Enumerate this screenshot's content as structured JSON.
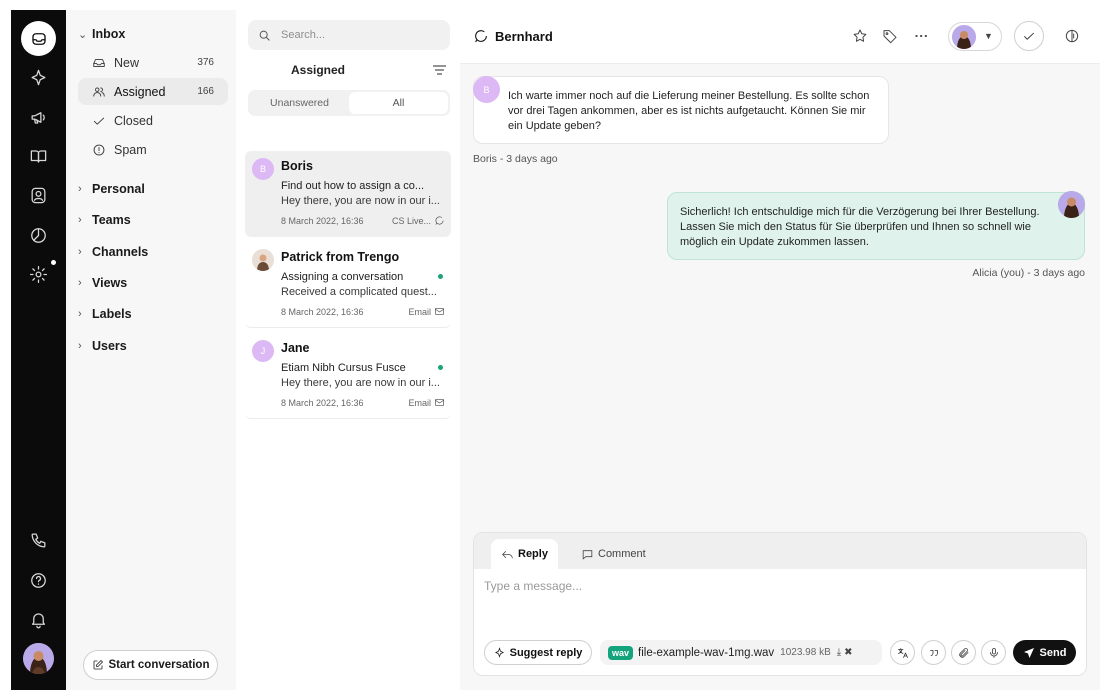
{
  "rail": {
    "icons": [
      "inbox-icon",
      "sparkle-icon",
      "megaphone-icon",
      "book-icon",
      "contacts-icon",
      "reports-icon",
      "settings-icon",
      "phone-icon",
      "help-icon",
      "bell-icon"
    ]
  },
  "nav": {
    "inbox_label": "Inbox",
    "items": [
      {
        "label": "New",
        "count": "376"
      },
      {
        "label": "Assigned",
        "count": "166"
      },
      {
        "label": "Closed",
        "count": ""
      },
      {
        "label": "Spam",
        "count": ""
      }
    ],
    "groups": [
      "Personal",
      "Teams",
      "Channels",
      "Views",
      "Labels",
      "Users"
    ],
    "start_label": "Start conversation"
  },
  "list": {
    "search_placeholder": "Search...",
    "title": "Assigned",
    "filters": [
      "Unanswered",
      "All"
    ],
    "active_filter": "All",
    "conversations": [
      {
        "initial": "B",
        "name": "Boris",
        "subject": "Find out how to assign a co...",
        "preview": "Hey there, you are now in our i...",
        "date": "8 March 2022, 16:36",
        "channel": "CS Live...",
        "unread": false
      },
      {
        "initial": "",
        "name": "Patrick from Trengo",
        "subject": "Assigning a conversation",
        "preview": "Received a complicated quest...",
        "date": "8 March 2022, 16:36",
        "channel": "Email",
        "unread": true
      },
      {
        "initial": "J",
        "name": "Jane",
        "subject": "Etiam Nibh Cursus Fusce",
        "preview": "Hey there, you are now in our i...",
        "date": "8 March 2022, 16:36",
        "channel": "Email",
        "unread": true
      }
    ]
  },
  "chat": {
    "contact_name": "Bernhard",
    "incoming": {
      "initial": "B",
      "text": "Ich warte immer noch auf die Lieferung meiner Bestellung. Es sollte schon vor drei Tagen ankommen, aber es ist nichts aufgetaucht. Können Sie mir ein Update geben?",
      "meta": "Boris - 3 days ago"
    },
    "outgoing": {
      "text": "Sicherlich! Ich entschuldige mich für die Verzögerung bei Ihrer Bestellung. Lassen Sie mich den Status für Sie überprüfen und Ihnen so schnell wie möglich ein Update zukommen lassen.",
      "meta": "Alicia (you) - 3 days ago"
    }
  },
  "composer": {
    "tab_reply": "Reply",
    "tab_comment": "Comment",
    "placeholder": "Type a message...",
    "suggest_label": "Suggest reply",
    "attachment": {
      "badge": "wav",
      "name": "file-example-wav-1mg.wav",
      "size": "1023.98 kB"
    },
    "send_label": "Send"
  },
  "colors": {
    "accent_green": "#14a37c",
    "bubble_out": "#dff3ec",
    "rail": "#0b0b0b"
  }
}
